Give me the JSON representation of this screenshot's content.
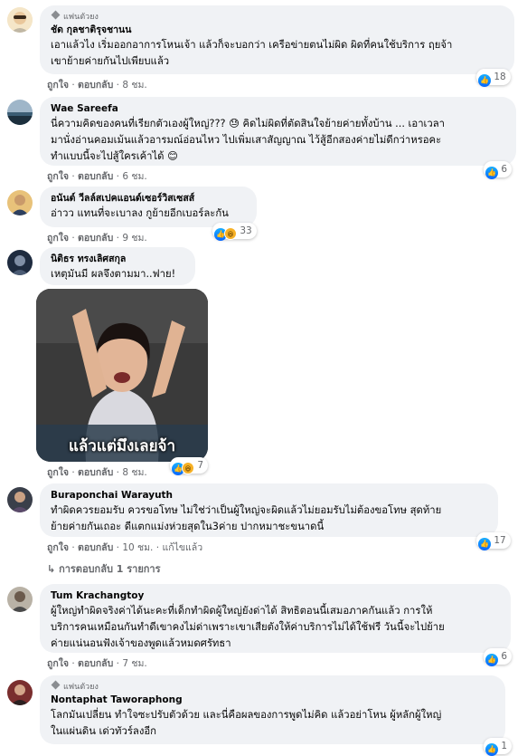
{
  "labels": {
    "like": "ถูกใจ",
    "reply": "ตอบกลับ",
    "dot": "·",
    "fan_badge": "แฟนตัวยง"
  },
  "comments": [
    {
      "name": "ชัด กุลชาติรุจชานน",
      "text": "เอาแล้วไง เริ่มออกอาการโหนเจ้า แล้วก็จะบอกว่า เครือข่ายตนไม่ผิด ผิดที่คนใช้บริการ ฤยจ้า\nเขาย้ายค่ายกันไปเพียบแล้ว",
      "time": "8 ชม.",
      "reactions": "18"
    },
    {
      "name": "Wae Sareefa",
      "text": "นี่ความคิดของคนที่เรียกตัวเองผู้ใหญ่??? 😓 คิดไม่ผิดที่ตัดสินใจย้ายค่ายทั้งบ้าน ... เอาเวลา\nมานั่งอ่านคอมเม้นแล้วอารมณ์อ่อนไหว ไปเพิ่มเสาสัญญาณ ไว้สู้อีกสองค่ายไม่ดีกว่าหรอคะ\nทำแบบนี้จะไปสู้ใครเค้าได้ 😊",
      "time": "6 ชม.",
      "reactions": "6"
    },
    {
      "name": "อนันต์ วีลล์สเปคแอนด์เซอร์วิสเซสส์",
      "text": "อ่าวว แทนที่จะเบาลง กูย้ายอีกเบอร์ละกัน",
      "time": "9 ชม.",
      "reactions": "33"
    },
    {
      "name": "นิติธร ทรงเลิศสกุล",
      "text": "เหตุมันมี ผลจึงตามมา..ฟาย!",
      "time": "8 ชม.",
      "reactions": "7",
      "meme_text": "แล้วแต่มึงเลยจ้า"
    },
    {
      "name": "Buraponchai Warayuth",
      "text": "ทำผิดควรยอมรับ ควรขอโทษ ไม่ใช่ว่าเป็นผู้ใหญ่จะผิดแล้วไม่ยอมรับไม่ต้องขอโทษ สุดท้าย\nย้ายค่ายกันเถอะ ดีแตกแม่งห่วยสุดใน3ค่าย ปากหมาชะขนาดนี้",
      "time": "10 ชม.",
      "edited": "แก้ไขแล้ว",
      "reactions": "17",
      "replies": "การตอบกลับ 1 รายการ"
    },
    {
      "name": "Tum Krachangtoy",
      "text": "ผู้ใหญ่ทำผิดจริงค่าได้นะคะที่เด็กทำผิดผู้ใหญ่ยังด่าได้ สิทธิตอนนี้เสมอภาคกันแล้ว การให้\nบริการคนเหมือนกันทำดีเขาคงไม่ด่าเพราะเขาเสียตังให้ค่าบริการไม่ได้ใช้ฟรี วันนี้จะไปย้าย\nค่ายแน่นอนฟังเจ้าของพูดแล้วหมดศรัทธา",
      "time": "7 ชม.",
      "reactions": "6"
    },
    {
      "name": "Nontaphat Taworaphong",
      "text": "โลกมันเปลี่ยน ทำใจซะปรับตัวด้วย และนี่คือผลของการพูดไม่คิด แล้วอย่าโหน ผู้หลักผู้ใหญ่\nในแผ่นดิน เด่วทัวร์ลงอีก",
      "reactions": "1"
    }
  ],
  "colors": {
    "bubble": "#f0f2f5",
    "like_blue": "#0866ff",
    "meta": "#65676b"
  }
}
